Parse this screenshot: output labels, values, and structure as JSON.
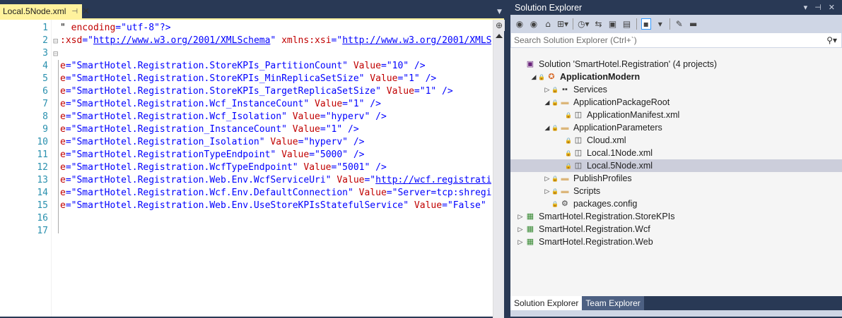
{
  "editor": {
    "tab_title": "Local.5Node.xml",
    "tab_pin": "⊣",
    "tab_close": "✕",
    "line_numbers": [
      "1",
      "2",
      "3",
      "4",
      "5",
      "6",
      "7",
      "8",
      "9",
      "10",
      "11",
      "12",
      "13",
      "14",
      "15",
      "16",
      "17"
    ],
    "lines": [
      [
        {
          "t": "\" ",
          "c": "d"
        },
        {
          "t": "encoding",
          "c": "r"
        },
        {
          "t": "=\"",
          "c": "b"
        },
        {
          "t": "utf-8",
          "c": "b"
        },
        {
          "t": "\"?>",
          "c": "b"
        }
      ],
      [
        {
          "t": ":xsd",
          "c": "r"
        },
        {
          "t": "=\"",
          "c": "b"
        },
        {
          "t": "http://www.w3.org/2001/XMLSchema",
          "c": "u"
        },
        {
          "t": "\" ",
          "c": "b"
        },
        {
          "t": "xmlns:xsi",
          "c": "r"
        },
        {
          "t": "=\"",
          "c": "b"
        },
        {
          "t": "http://www.w3.org/2001/XMLS",
          "c": "u"
        }
      ],
      [],
      [
        {
          "t": "e",
          "c": "r"
        },
        {
          "t": "=\"SmartHotel.Registration.StoreKPIs_PartitionCount\" ",
          "c": "b"
        },
        {
          "t": "Value",
          "c": "r"
        },
        {
          "t": "=\"10\" />",
          "c": "b"
        }
      ],
      [
        {
          "t": "e",
          "c": "r"
        },
        {
          "t": "=\"SmartHotel.Registration.StoreKPIs_MinReplicaSetSize\" ",
          "c": "b"
        },
        {
          "t": "Value",
          "c": "r"
        },
        {
          "t": "=\"1\" />",
          "c": "b"
        }
      ],
      [
        {
          "t": "e",
          "c": "r"
        },
        {
          "t": "=\"SmartHotel.Registration.StoreKPIs_TargetReplicaSetSize\" ",
          "c": "b"
        },
        {
          "t": "Value",
          "c": "r"
        },
        {
          "t": "=\"1\" />",
          "c": "b"
        }
      ],
      [
        {
          "t": "e",
          "c": "r"
        },
        {
          "t": "=\"SmartHotel.Registration.Wcf_InstanceCount\" ",
          "c": "b"
        },
        {
          "t": "Value",
          "c": "r"
        },
        {
          "t": "=\"1\" />",
          "c": "b"
        }
      ],
      [
        {
          "t": "e",
          "c": "r"
        },
        {
          "t": "=\"SmartHotel.Registration.Wcf_Isolation\" ",
          "c": "b"
        },
        {
          "t": "Value",
          "c": "r"
        },
        {
          "t": "=\"hyperv\" />",
          "c": "b"
        }
      ],
      [
        {
          "t": "e",
          "c": "r"
        },
        {
          "t": "=\"SmartHotel.Registration_InstanceCount\" ",
          "c": "b"
        },
        {
          "t": "Value",
          "c": "r"
        },
        {
          "t": "=\"1\" />",
          "c": "b"
        }
      ],
      [
        {
          "t": "e",
          "c": "r"
        },
        {
          "t": "=\"SmartHotel.Registration_Isolation\" ",
          "c": "b"
        },
        {
          "t": "Value",
          "c": "r"
        },
        {
          "t": "=\"hyperv\" />",
          "c": "b"
        }
      ],
      [
        {
          "t": "e",
          "c": "r"
        },
        {
          "t": "=\"SmartHotel.RegistrationTypeEndpoint\" ",
          "c": "b"
        },
        {
          "t": "Value",
          "c": "r"
        },
        {
          "t": "=\"5000\" />",
          "c": "b"
        }
      ],
      [
        {
          "t": "e",
          "c": "r"
        },
        {
          "t": "=\"SmartHotel.Registration.WcfTypeEndpoint\" ",
          "c": "b"
        },
        {
          "t": "Value",
          "c": "r"
        },
        {
          "t": "=\"5001\" />",
          "c": "b"
        }
      ],
      [
        {
          "t": "e",
          "c": "r"
        },
        {
          "t": "=\"SmartHotel.Registration.Web.Env.WcfServiceUri\" ",
          "c": "b"
        },
        {
          "t": "Value",
          "c": "r"
        },
        {
          "t": "=\"",
          "c": "b"
        },
        {
          "t": "http://wcf.registrati",
          "c": "u"
        }
      ],
      [
        {
          "t": "e",
          "c": "r"
        },
        {
          "t": "=\"SmartHotel.Registration.Wcf.Env.DefaultConnection\" ",
          "c": "b"
        },
        {
          "t": "Value",
          "c": "r"
        },
        {
          "t": "=\"Server=tcp:shregi",
          "c": "b"
        }
      ],
      [
        {
          "t": "e",
          "c": "r"
        },
        {
          "t": "=\"SmartHotel.Registration.Web.Env.UseStoreKPIsStatefulService\" ",
          "c": "b"
        },
        {
          "t": "Value",
          "c": "r"
        },
        {
          "t": "=\"False\" ",
          "c": "b"
        }
      ],
      [],
      []
    ]
  },
  "solution_explorer": {
    "title": "Solution Explorer",
    "title_controls": [
      "▾",
      "⊣",
      "✕"
    ],
    "search_placeholder": "Search Solution Explorer (Ctrl+`)",
    "search_icon": "⚲",
    "toolbar_icons": [
      "back-icon",
      "forward-icon",
      "home-icon",
      "switch-views-icon",
      "history-icon",
      "sync-icon",
      "collapse-all-icon",
      "show-all-files-icon",
      "preview-icon",
      "properties-icon",
      "settings-icon"
    ],
    "tree": [
      {
        "label": "Solution 'SmartHotel.Registration' (4 projects)",
        "indent": 0,
        "icon": "solution-icon",
        "exp": "",
        "bold": false,
        "sel": false
      },
      {
        "label": "ApplicationModern",
        "indent": 1,
        "icon": "app-icon",
        "exp": "◢",
        "bold": true,
        "sel": false
      },
      {
        "label": "Services",
        "indent": 2,
        "icon": "services-icon",
        "exp": "▷",
        "bold": false,
        "sel": false
      },
      {
        "label": "ApplicationPackageRoot",
        "indent": 2,
        "icon": "folder-icon",
        "exp": "◢",
        "bold": false,
        "sel": false
      },
      {
        "label": "ApplicationManifest.xml",
        "indent": 3,
        "icon": "xml-file-icon",
        "exp": "",
        "bold": false,
        "sel": false
      },
      {
        "label": "ApplicationParameters",
        "indent": 2,
        "icon": "folder-icon",
        "exp": "◢",
        "bold": false,
        "sel": false
      },
      {
        "label": "Cloud.xml",
        "indent": 3,
        "icon": "xml-file-icon",
        "exp": "",
        "bold": false,
        "sel": false
      },
      {
        "label": "Local.1Node.xml",
        "indent": 3,
        "icon": "xml-file-icon",
        "exp": "",
        "bold": false,
        "sel": false
      },
      {
        "label": "Local.5Node.xml",
        "indent": 3,
        "icon": "xml-file-icon",
        "exp": "",
        "bold": false,
        "sel": true
      },
      {
        "label": "PublishProfiles",
        "indent": 2,
        "icon": "folder-icon",
        "exp": "▷",
        "bold": false,
        "sel": false
      },
      {
        "label": "Scripts",
        "indent": 2,
        "icon": "folder-icon",
        "exp": "▷",
        "bold": false,
        "sel": false
      },
      {
        "label": "packages.config",
        "indent": 2,
        "icon": "config-file-icon",
        "exp": "",
        "bold": false,
        "sel": false
      },
      {
        "label": "SmartHotel.Registration.StoreKPIs",
        "indent": 0,
        "icon": "project-icon",
        "exp": "▷",
        "bold": false,
        "sel": false
      },
      {
        "label": "SmartHotel.Registration.Wcf",
        "indent": 0,
        "icon": "project-icon",
        "exp": "▷",
        "bold": false,
        "sel": false
      },
      {
        "label": "SmartHotel.Registration.Web",
        "indent": 0,
        "icon": "project-icon",
        "exp": "▷",
        "bold": false,
        "sel": false
      }
    ],
    "tabs": [
      "Solution Explorer",
      "Team Explorer"
    ]
  }
}
